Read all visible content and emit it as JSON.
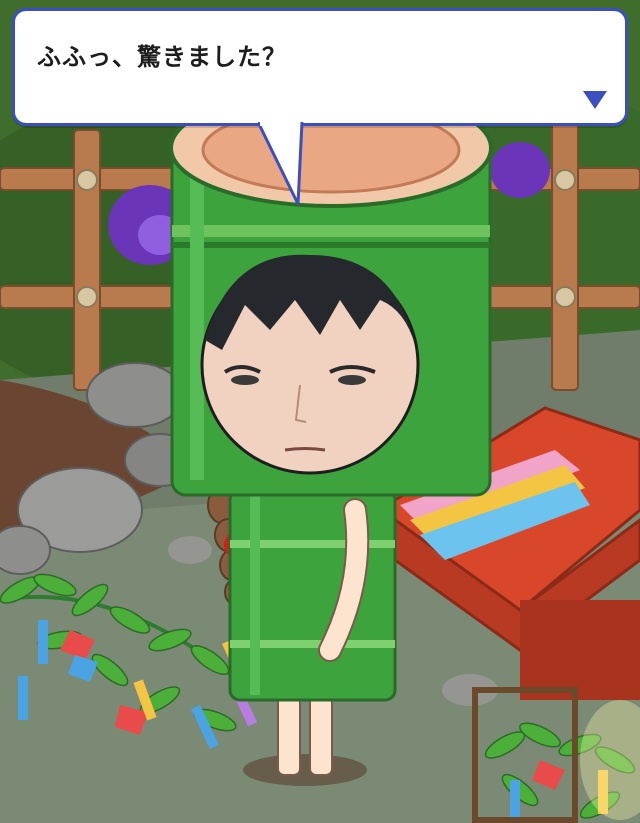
{
  "dialog": {
    "text": "ふふっ、驚きました？",
    "advance_icon": "triangle-down-icon"
  },
  "scene": {
    "description_colors": {
      "dialog_border": "#3b4fc2",
      "bamboo_green": "#3da33d",
      "table_red": "#d9472b"
    }
  }
}
